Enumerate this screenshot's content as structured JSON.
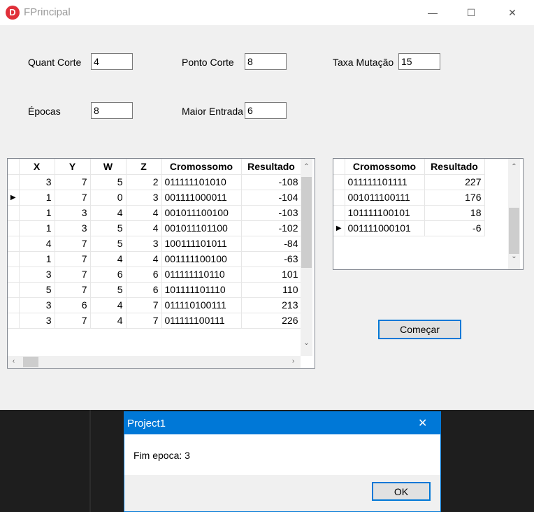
{
  "window": {
    "title": "FPrincipal",
    "icon": "D",
    "minimize": "—",
    "maximize": "☐",
    "close": "✕"
  },
  "form": {
    "quant_corte": {
      "label": "Quant Corte",
      "value": "4"
    },
    "ponto_corte": {
      "label": "Ponto Corte",
      "value": "8"
    },
    "taxa_mutacao": {
      "label": "Taxa Mutação",
      "value": "15"
    },
    "epocas": {
      "label": "Épocas",
      "value": "8"
    },
    "maior_entrada": {
      "label": "Maior Entrada",
      "value": "6"
    }
  },
  "grid1": {
    "columns": [
      "X",
      "Y",
      "W",
      "Z",
      "Cromossomo",
      "Resultado"
    ],
    "current_row": 1,
    "rows": [
      [
        "3",
        "7",
        "5",
        "2",
        "011111101010",
        "-108"
      ],
      [
        "1",
        "7",
        "0",
        "3",
        "001111000011",
        "-104"
      ],
      [
        "1",
        "3",
        "4",
        "4",
        "001011100100",
        "-103"
      ],
      [
        "1",
        "3",
        "5",
        "4",
        "001011101100",
        "-102"
      ],
      [
        "4",
        "7",
        "5",
        "3",
        "100111101011",
        "-84"
      ],
      [
        "1",
        "7",
        "4",
        "4",
        "001111100100",
        "-63"
      ],
      [
        "3",
        "7",
        "6",
        "6",
        "011111110110",
        "101"
      ],
      [
        "5",
        "7",
        "5",
        "6",
        "101111101110",
        "110"
      ],
      [
        "3",
        "6",
        "4",
        "7",
        "011110100111",
        "213"
      ],
      [
        "3",
        "7",
        "4",
        "7",
        "011111100111",
        "226"
      ]
    ]
  },
  "grid2": {
    "columns": [
      "Cromossomo",
      "Resultado"
    ],
    "current_row": 3,
    "rows": [
      [
        "011111101111",
        "227"
      ],
      [
        "001011100111",
        "176"
      ],
      [
        "101111100101",
        "18"
      ],
      [
        "001111000101",
        "-6"
      ]
    ]
  },
  "start_button": "Começar",
  "dialog": {
    "title": "Project1",
    "message": "Fim epoca: 3",
    "ok": "OK",
    "close": "✕"
  }
}
